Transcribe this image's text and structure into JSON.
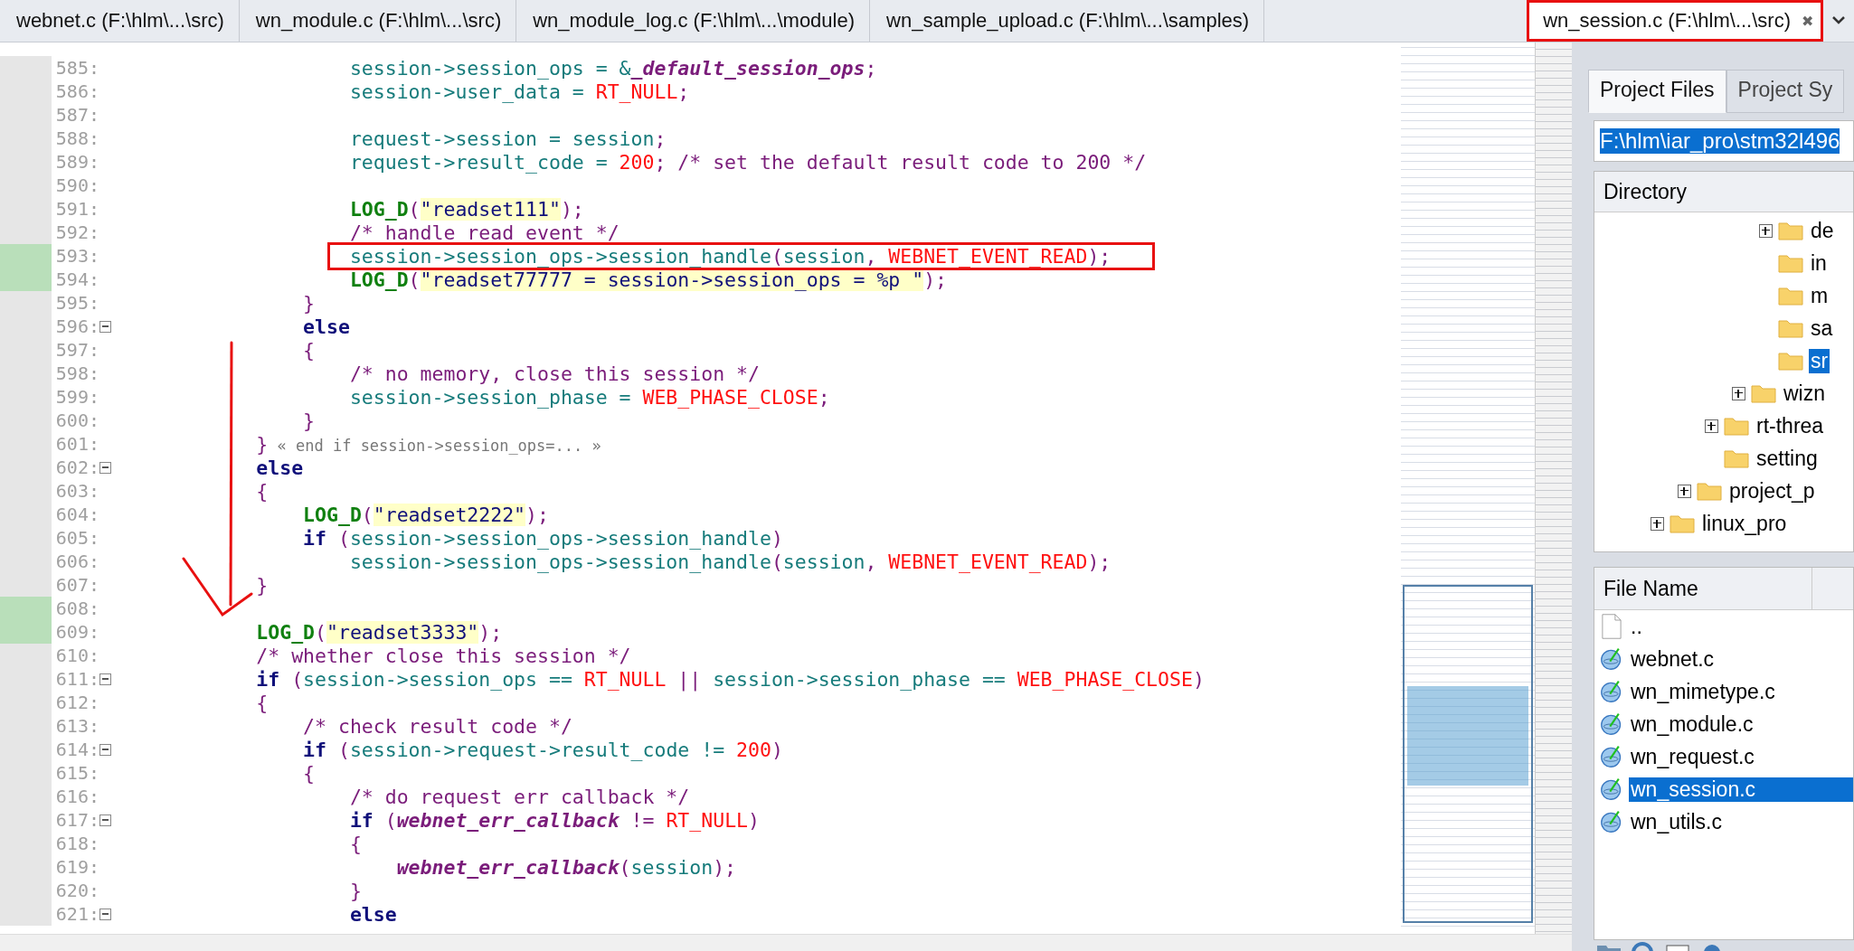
{
  "tabs": [
    {
      "label": "webnet.c (F:\\hlm\\...\\src)",
      "selected": false
    },
    {
      "label": "wn_module.c (F:\\hlm\\...\\src)",
      "selected": false
    },
    {
      "label": "wn_module_log.c (F:\\hlm\\...\\module)",
      "selected": false
    },
    {
      "label": "wn_sample_upload.c (F:\\hlm\\...\\samples)",
      "selected": false
    },
    {
      "label": "wn_session.c (F:\\hlm\\...\\src)",
      "selected": true,
      "close": "✖"
    }
  ],
  "code": {
    "lines": [
      {
        "number": "585:",
        "changed": false,
        "fold": false,
        "tokens": [
          {
            "kind": "var",
            "text": "                    session->session_ops = &"
          },
          {
            "kind": "gfn",
            "text": "_default_session_ops"
          },
          {
            "kind": "punc",
            "text": ";"
          }
        ]
      },
      {
        "number": "586:",
        "changed": false,
        "fold": false,
        "tokens": [
          {
            "kind": "var",
            "text": "                    session->user_data = "
          },
          {
            "kind": "const",
            "text": "RT_NULL"
          },
          {
            "kind": "punc",
            "text": ";"
          }
        ]
      },
      {
        "number": "587:",
        "changed": false,
        "fold": false
      },
      {
        "number": "588:",
        "changed": false,
        "fold": false,
        "tokens": [
          {
            "kind": "var",
            "text": "                    request->session = session"
          },
          {
            "kind": "punc",
            "text": ";"
          }
        ]
      },
      {
        "number": "589:",
        "changed": false,
        "fold": false,
        "tokens": [
          {
            "kind": "var",
            "text": "                    request->result_code = "
          },
          {
            "kind": "const",
            "text": "200"
          },
          {
            "kind": "punc",
            "text": "; "
          },
          {
            "kind": "cmt",
            "text": "/* set the default result code to 200 */"
          }
        ]
      },
      {
        "number": "590:",
        "changed": false,
        "fold": false
      },
      {
        "number": "591:",
        "changed": false,
        "fold": false,
        "tokens": [
          {
            "kind": "macro",
            "text": "                    LOG_D"
          },
          {
            "kind": "punc",
            "text": "("
          },
          {
            "kind": "str",
            "text": "\"readset111\""
          },
          {
            "kind": "punc",
            "text": ");"
          }
        ]
      },
      {
        "number": "592:",
        "changed": false,
        "fold": false,
        "tokens": [
          {
            "kind": "cmt",
            "text": "                    /* handle read event */"
          }
        ]
      },
      {
        "number": "593:",
        "changed": true,
        "fold": false,
        "tokens": [
          {
            "kind": "var",
            "text": "                    session->session_ops->session_handle"
          },
          {
            "kind": "punc",
            "text": "("
          },
          {
            "kind": "var",
            "text": "session"
          },
          {
            "kind": "punc",
            "text": ", "
          },
          {
            "kind": "const",
            "text": "WEBNET_EVENT_READ"
          },
          {
            "kind": "punc",
            "text": ");"
          }
        ]
      },
      {
        "number": "594:",
        "changed": true,
        "fold": false,
        "tokens": [
          {
            "kind": "macro",
            "text": "                    LOG_D"
          },
          {
            "kind": "punc",
            "text": "("
          },
          {
            "kind": "str",
            "text": "\"readset77777 = session->session_ops = %p \""
          },
          {
            "kind": "punc",
            "text": ");"
          }
        ]
      },
      {
        "number": "595:",
        "changed": false,
        "fold": false,
        "tokens": [
          {
            "kind": "punc",
            "text": "                }"
          }
        ]
      },
      {
        "number": "596:",
        "changed": false,
        "fold": true,
        "tokens": [
          {
            "kind": "kw",
            "text": "                else"
          }
        ]
      },
      {
        "number": "597:",
        "changed": false,
        "fold": false,
        "tokens": [
          {
            "kind": "punc",
            "text": "                {"
          }
        ]
      },
      {
        "number": "598:",
        "changed": false,
        "fold": false,
        "tokens": [
          {
            "kind": "cmt",
            "text": "                    /* no memory, close this session */"
          }
        ]
      },
      {
        "number": "599:",
        "changed": false,
        "fold": false,
        "tokens": [
          {
            "kind": "var",
            "text": "                    session->session_phase = "
          },
          {
            "kind": "const",
            "text": "WEB_PHASE_CLOSE"
          },
          {
            "kind": "punc",
            "text": ";"
          }
        ]
      },
      {
        "number": "600:",
        "changed": false,
        "fold": false,
        "tokens": [
          {
            "kind": "punc",
            "text": "                }"
          }
        ]
      },
      {
        "number": "601:",
        "changed": false,
        "fold": false,
        "tokens": [
          {
            "kind": "punc",
            "text": "            }"
          },
          {
            "kind": "note",
            "text": " « end if session->session_ops=... »"
          }
        ]
      },
      {
        "number": "602:",
        "changed": false,
        "fold": true,
        "tokens": [
          {
            "kind": "kw",
            "text": "            else"
          }
        ]
      },
      {
        "number": "603:",
        "changed": false,
        "fold": false,
        "tokens": [
          {
            "kind": "punc",
            "text": "            {"
          }
        ]
      },
      {
        "number": "604:",
        "changed": false,
        "fold": false,
        "tokens": [
          {
            "kind": "macro",
            "text": "                LOG_D"
          },
          {
            "kind": "punc",
            "text": "("
          },
          {
            "kind": "str",
            "text": "\"readset2222\""
          },
          {
            "kind": "punc",
            "text": ");"
          }
        ]
      },
      {
        "number": "605:",
        "changed": false,
        "fold": false,
        "tokens": [
          {
            "kind": "kw",
            "text": "                if"
          },
          {
            "kind": "punc",
            "text": " ("
          },
          {
            "kind": "var",
            "text": "session->session_ops->session_handle"
          },
          {
            "kind": "punc",
            "text": ")"
          }
        ]
      },
      {
        "number": "606:",
        "changed": false,
        "fold": false,
        "tokens": [
          {
            "kind": "var",
            "text": "                    session->session_ops->session_handle"
          },
          {
            "kind": "punc",
            "text": "("
          },
          {
            "kind": "var",
            "text": "session"
          },
          {
            "kind": "punc",
            "text": ", "
          },
          {
            "kind": "const",
            "text": "WEBNET_EVENT_READ"
          },
          {
            "kind": "punc",
            "text": ");"
          }
        ]
      },
      {
        "number": "607:",
        "changed": false,
        "fold": false,
        "tokens": [
          {
            "kind": "punc",
            "text": "            }"
          }
        ]
      },
      {
        "number": "608:",
        "changed": true,
        "fold": false
      },
      {
        "number": "609:",
        "changed": true,
        "fold": false,
        "tokens": [
          {
            "kind": "macro",
            "text": "            LOG_D"
          },
          {
            "kind": "punc",
            "text": "("
          },
          {
            "kind": "str",
            "text": "\"readset3333\""
          },
          {
            "kind": "punc",
            "text": ");"
          }
        ]
      },
      {
        "number": "610:",
        "changed": false,
        "fold": false,
        "tokens": [
          {
            "kind": "cmt",
            "text": "            /* whether close this session */"
          }
        ]
      },
      {
        "number": "611:",
        "changed": false,
        "fold": true,
        "tokens": [
          {
            "kind": "kw",
            "text": "            if"
          },
          {
            "kind": "punc",
            "text": " ("
          },
          {
            "kind": "var",
            "text": "session->session_ops == "
          },
          {
            "kind": "const",
            "text": "RT_NULL"
          },
          {
            "kind": "punc",
            "text": " || "
          },
          {
            "kind": "var",
            "text": "session->session_phase == "
          },
          {
            "kind": "const",
            "text": "WEB_PHASE_CLOSE"
          },
          {
            "kind": "punc",
            "text": ")"
          }
        ]
      },
      {
        "number": "612:",
        "changed": false,
        "fold": false,
        "tokens": [
          {
            "kind": "punc",
            "text": "            {"
          }
        ]
      },
      {
        "number": "613:",
        "changed": false,
        "fold": false,
        "tokens": [
          {
            "kind": "cmt",
            "text": "                /* check result code */"
          }
        ]
      },
      {
        "number": "614:",
        "changed": false,
        "fold": true,
        "tokens": [
          {
            "kind": "kw",
            "text": "                if"
          },
          {
            "kind": "punc",
            "text": " ("
          },
          {
            "kind": "var",
            "text": "session->request->result_code != "
          },
          {
            "kind": "const",
            "text": "200"
          },
          {
            "kind": "punc",
            "text": ")"
          }
        ]
      },
      {
        "number": "615:",
        "changed": false,
        "fold": false,
        "tokens": [
          {
            "kind": "punc",
            "text": "                {"
          }
        ]
      },
      {
        "number": "616:",
        "changed": false,
        "fold": false,
        "tokens": [
          {
            "kind": "cmt",
            "text": "                    /* do request err callback */"
          }
        ]
      },
      {
        "number": "617:",
        "changed": false,
        "fold": true,
        "tokens": [
          {
            "kind": "kw",
            "text": "                    if"
          },
          {
            "kind": "punc",
            "text": " ("
          },
          {
            "kind": "gfn",
            "text": "webnet_err_callback"
          },
          {
            "kind": "punc",
            "text": " != "
          },
          {
            "kind": "const",
            "text": "RT_NULL"
          },
          {
            "kind": "punc",
            "text": ")"
          }
        ]
      },
      {
        "number": "618:",
        "changed": false,
        "fold": false,
        "tokens": [
          {
            "kind": "punc",
            "text": "                    {"
          }
        ]
      },
      {
        "number": "619:",
        "changed": false,
        "fold": false,
        "tokens": [
          {
            "kind": "gfn",
            "text": "                        webnet_err_callback"
          },
          {
            "kind": "punc",
            "text": "("
          },
          {
            "kind": "var",
            "text": "session"
          },
          {
            "kind": "punc",
            "text": ");"
          }
        ]
      },
      {
        "number": "620:",
        "changed": false,
        "fold": false,
        "tokens": [
          {
            "kind": "punc",
            "text": "                    }"
          }
        ]
      },
      {
        "number": "621:",
        "changed": false,
        "fold": true,
        "tokens": [
          {
            "kind": "kw",
            "text": "                    else"
          }
        ]
      }
    ]
  },
  "sidebar": {
    "tabs": [
      {
        "label": "Project Files",
        "selected": true
      },
      {
        "label": "Project Sy",
        "selected": false
      }
    ],
    "path": {
      "value": "F:\\hlm\\iar_pro\\stm32l496"
    },
    "directory": {
      "header": "Directory",
      "tree": [
        {
          "children": [
            {
              "children": [
                {
                  "children": [
                    {
                      "children": [
                        {
                          "children": [
                            {
                              "label": "de",
                              "expandable": true,
                              "selected": false
                            },
                            {
                              "label": "in",
                              "expandable": false,
                              "selected": false
                            },
                            {
                              "label": "m",
                              "expandable": false,
                              "selected": false
                            },
                            {
                              "label": "sa",
                              "expandable": false,
                              "selected": false
                            },
                            {
                              "label": "sr",
                              "expandable": false,
                              "selected": true
                            }
                          ]
                        },
                        {
                          "label": "wizn",
                          "expandable": true,
                          "selected": false
                        }
                      ]
                    },
                    {
                      "label": "rt-threa",
                      "expandable": true,
                      "selected": false
                    },
                    {
                      "label": "setting",
                      "expandable": false,
                      "selected": false
                    }
                  ]
                },
                {
                  "label": "project_p",
                  "expandable": true,
                  "selected": false
                }
              ]
            },
            {
              "label": "linux_pro",
              "expandable": true,
              "selected": false
            }
          ]
        }
      ]
    },
    "files": {
      "header": "File Name",
      "items": [
        {
          "name": "..",
          "kind": "parent",
          "selected": false
        },
        {
          "name": "webnet.c",
          "kind": "source",
          "selected": false
        },
        {
          "name": "wn_mimetype.c",
          "kind": "source",
          "selected": false
        },
        {
          "name": "wn_module.c",
          "kind": "source",
          "selected": false
        },
        {
          "name": "wn_request.c",
          "kind": "source",
          "selected": false
        },
        {
          "name": "wn_session.c",
          "kind": "source",
          "selected": true
        },
        {
          "name": "wn_utils.c",
          "kind": "source",
          "selected": false
        }
      ]
    }
  }
}
